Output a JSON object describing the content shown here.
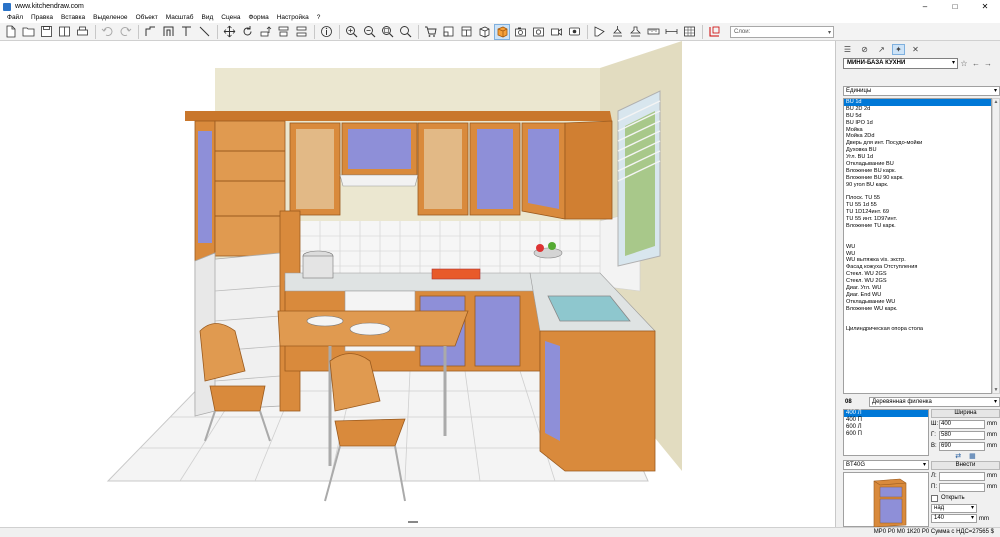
{
  "window": {
    "title": "www.kitchendraw.com",
    "controls": [
      "minimize",
      "maximize",
      "close"
    ]
  },
  "menu": [
    "Файл",
    "Правка",
    "Вставка",
    "Выделеное",
    "Объект",
    "Масштаб",
    "Вид",
    "Сцена",
    "Форма",
    "Настройка",
    "?"
  ],
  "toolbar": {
    "layer_placeholder": "Слои:"
  },
  "panel": {
    "catalog": "МИНИ-БАЗА КУХНИ",
    "units": "Единицы",
    "modules": [
      "BU  1d",
      "BU 2D 2d",
      "BU 5d",
      "BU  IPO 1d",
      "Мойка",
      "Мойка  2Dd",
      "Дверь для инт. Посудо-мойки",
      "Духовка BU",
      "Угл. BU  1d",
      "Откладывание BU",
      "Вложение BU карк.",
      "Вложение BU 90  карк.",
      "90  угол BU карк.",
      "",
      "Плоск. TU 55",
      "TU 55 1d  55",
      "TU 1D124инт. 69",
      "TU 55 инт.  1D97инт.",
      "Вложение TU карк.",
      "",
      "",
      "WU",
      "WU",
      "WU вытяжка vis. экстр.",
      "Фасад кожуха Отступления",
      "Стекл. WU  2GS",
      "Стекл. WU  2GS",
      "Диаг. Угл. WU",
      "Диаг. End WU",
      "Откладывание WU",
      "Вложение WU карк.",
      "",
      "",
      "Цилиндрическая опора стола"
    ],
    "selected_module": 0,
    "finish_code": "08",
    "finish_name": "Деревянная филенка",
    "sizes": [
      "400 Л",
      "400 П",
      "600 Л",
      "600 П"
    ],
    "selected_size": 0,
    "width_header": "Ширина",
    "dims": [
      {
        "label": "Ш:",
        "value": "400",
        "unit": "mm"
      },
      {
        "label": "Г:",
        "value": "580",
        "unit": "mm"
      },
      {
        "label": "В:",
        "value": "690",
        "unit": "mm"
      }
    ],
    "reference": "BT40G",
    "insert_header": "Внести",
    "insert_l_label": "Л:",
    "insert_l_unit": "mm",
    "insert_p_label": "П:",
    "insert_p_unit": "mm",
    "open_label": "Открыть",
    "position": "над",
    "height_value": "140",
    "height_unit": "mm"
  },
  "status": "МР0 Р0 М0 1К20 Р0 Сумма с НДС=27565 $",
  "colors": {
    "wood": "#d98a3c",
    "door_panel": "#8e8fd8",
    "wall": "#ece8d2",
    "selection": "#0078d7"
  }
}
